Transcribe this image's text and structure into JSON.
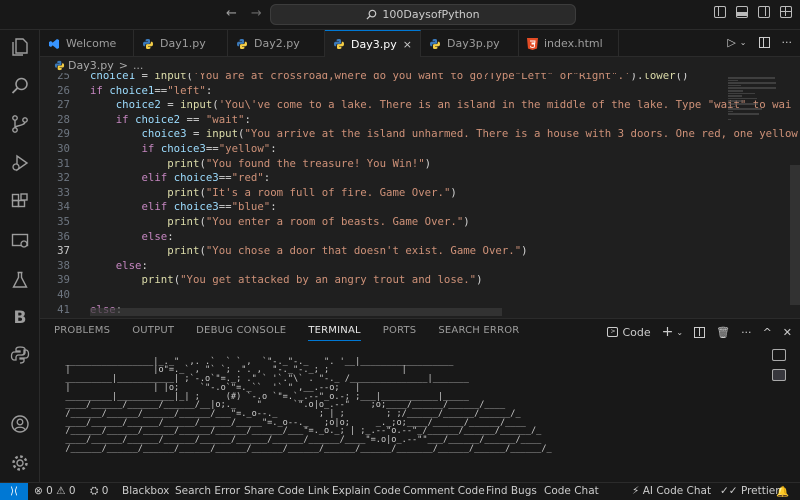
{
  "titlebar": {
    "search_text": "100DaysofPython"
  },
  "tabs": [
    {
      "label": "Welcome",
      "icon": "vscode-icon"
    },
    {
      "label": "Day1.py",
      "icon": "python-icon"
    },
    {
      "label": "Day2.py",
      "icon": "python-icon"
    },
    {
      "label": "Day3.py",
      "icon": "python-icon",
      "active": true,
      "close": "×"
    },
    {
      "label": "Day3p.py",
      "icon": "python-icon"
    },
    {
      "label": "index.html",
      "icon": "html5-icon"
    }
  ],
  "breadcrumb": {
    "file": "Day3.py",
    "sep": ">",
    "rest": "..."
  },
  "editor": {
    "current_line": "37",
    "lines": [
      {
        "n": "25",
        "text": "choice1 = input('You are at crossroad,where do you want to go?Type\"Left\" or\"Right\".').lower()"
      },
      {
        "n": "26",
        "text": "if choice1==\"left\":"
      },
      {
        "n": "27",
        "text": "    choice2 = input('You\\'ve come to a lake. There is an island in the middle of the lake. Type \"wait\" to wai"
      },
      {
        "n": "28",
        "text": "    if choice2 == \"wait\":"
      },
      {
        "n": "29",
        "text": "        choice3 = input(\"You arrive at the island unharmed. There is a house with 3 doors. One red, one yellow"
      },
      {
        "n": "30",
        "text": "        if choice3==\"yellow\":"
      },
      {
        "n": "31",
        "text": "            print(\"You found the treasure! You Win!\")"
      },
      {
        "n": "32",
        "text": "        elif choice3==\"red\":"
      },
      {
        "n": "33",
        "text": "            print(\"It's a room full of fire. Game Over.\")"
      },
      {
        "n": "34",
        "text": "        elif choice3==\"blue\":"
      },
      {
        "n": "35",
        "text": "            print(\"You enter a room of beasts. Game Over.\")"
      },
      {
        "n": "36",
        "text": "        else:"
      },
      {
        "n": "37",
        "text": "            print(\"You chose a door that doesn't exist. Game Over.\")"
      },
      {
        "n": "38",
        "text": "    else:"
      },
      {
        "n": "39",
        "text": "        print(\"You get attacked by an angry trout and lose.\")"
      },
      {
        "n": "40",
        "text": ""
      },
      {
        "n": "41",
        "text": "else:"
      }
    ]
  },
  "panel": {
    "tabs": [
      "PROBLEMS",
      "OUTPUT",
      "DEBUG CONSOLE",
      "TERMINAL",
      "PORTS",
      "SEARCH ERROR"
    ],
    "active_tab": "TERMINAL",
    "terminal_label": "Code",
    "ascii_art": [
      "",
      "  _________________|_._\"  ,. .`  ` ` ,  `\"-._\"-._   \". '__|__________________",
      "  |                |o\"=._` , \"` `; .\". ,  \"-._\"-._; ;              |",
      "  _________|___________| ;`-.o`\"=._; .\" ` '`.\"\\` . \"-._ /_______________|_______",
      "  |                | |o;    `\"-.o`\"=._``  '` \" ,__.--o;   |",
      "  _________|___________|_| ;     (#) `-.o `\"=.`_.--\"_o.-; ;___|___________|_____",
      "  ____/______/______/______/__|o;._    \"      `\".o|o_.--\"    ;o;____/______/______/____",
      "  /______/______/______/______/___\"=._o--._        ; | ;        ; ;/______/______/______/_",
      "  ____/______/______/______/______/_____\"=._o--._   ;o|o;     _._;o;____/______/______/____",
      "  /______/______/______/______/______/______/___\"=._o._; | ;_.--\"o.--\"_/______/______/______/_",
      "  ____/______/______/______/______/______/______/______/____\"=.o|o_.--\"\"___/______/______/____",
      "  /______/______/______/______/______/______/______/______/______/_______/______/______/______/_"
    ]
  },
  "statusbar": {
    "errors": "0",
    "warnings": "0",
    "ports": "0",
    "items": [
      "Blackbox",
      "Search Error",
      "Share Code Link",
      "Explain Code",
      "Comment Code",
      "Find Bugs",
      "Code Chat"
    ],
    "ai_chat": "AI Code Chat",
    "prettier": "Prettier"
  },
  "colors": {
    "accent": "#0078d4",
    "background": "#1f1f1f",
    "sidebar": "#181818"
  }
}
